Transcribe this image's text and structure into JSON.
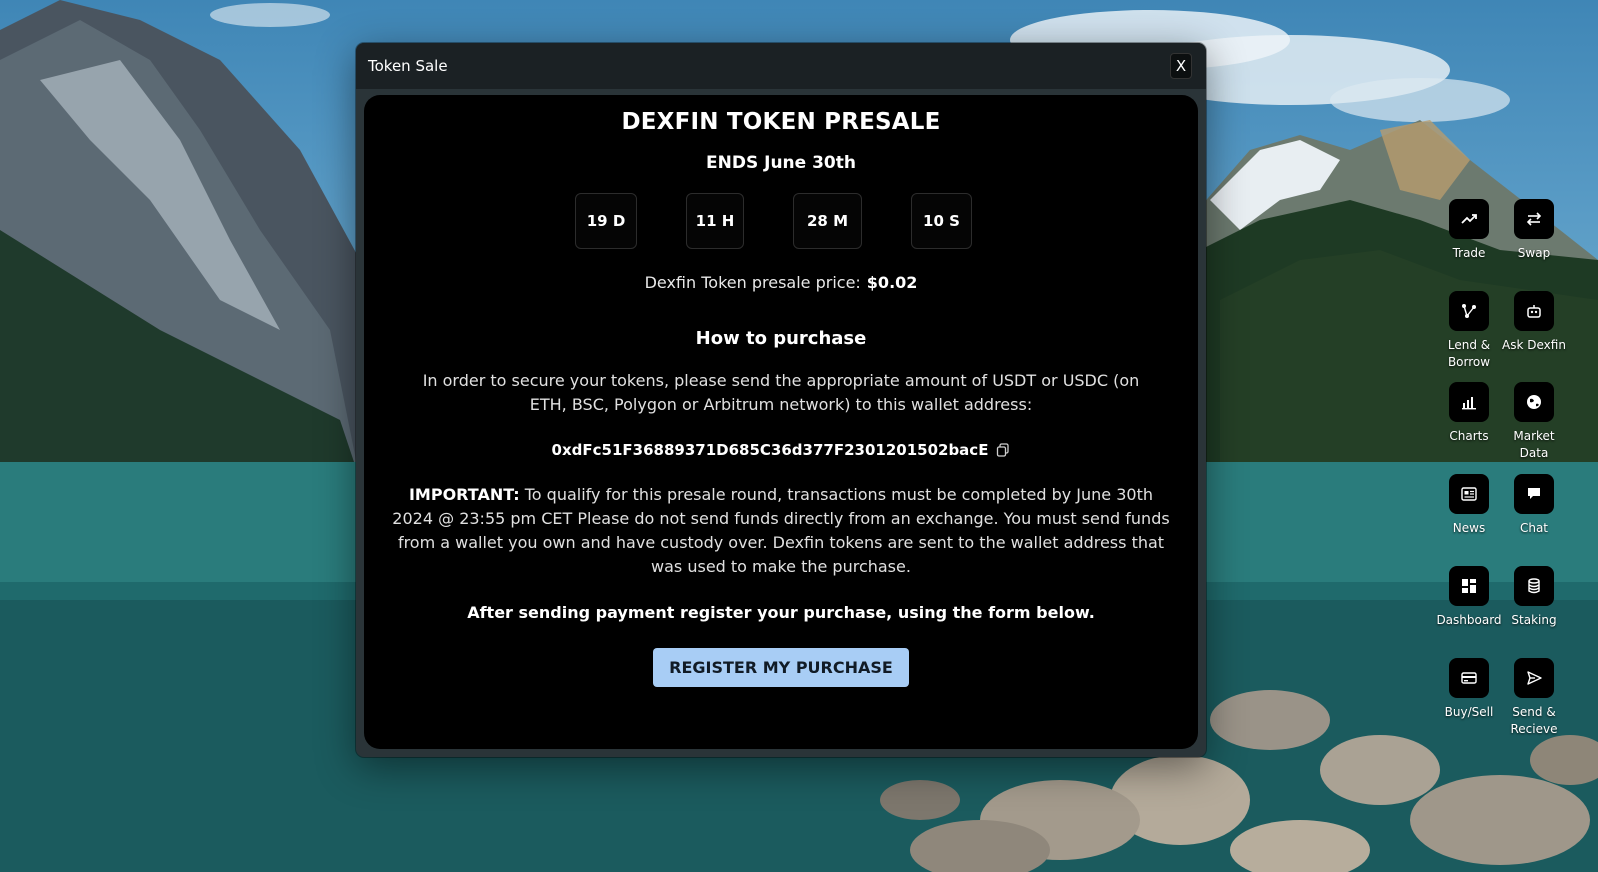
{
  "window": {
    "title": "Token Sale",
    "close_label": "X"
  },
  "presale": {
    "heading": "DEXFIN TOKEN PRESALE",
    "ends": "ENDS June 30th",
    "countdown": {
      "days": "19 D",
      "hours": "11 H",
      "minutes": "28 M",
      "seconds": "10 S"
    },
    "price_label": "Dexfin Token presale price:",
    "price_value": "$0.02",
    "how_heading": "How to purchase",
    "instructions": "In order to secure your tokens, please send the appropriate amount of USDT or USDC (on ETH, BSC, Polygon or Arbitrum network) to this wallet address:",
    "wallet_address": "0xdFc51F36889371D685C36d377F2301201502bacE",
    "important_label": "IMPORTANT:",
    "important_text": " To qualify for this presale round, transactions must be completed by June 30th 2024 @ 23:55 pm CET Please do not send funds directly from an exchange. You must send funds from a wallet you own and have custody over. Dexfin tokens are sent to the wallet address that was used to make the purchase.",
    "after_text": "After sending payment register your purchase, using the form below.",
    "register_button": "REGISTER MY PURCHASE"
  },
  "desktop_icons": [
    {
      "label": "Trade",
      "icon": "trend-up-icon"
    },
    {
      "label": "Swap",
      "icon": "swap-arrows-icon"
    },
    {
      "label": "Lend & Borrow",
      "icon": "nodes-icon"
    },
    {
      "label": "Ask Dexfin",
      "icon": "robot-icon"
    },
    {
      "label": "Charts",
      "icon": "bar-chart-icon"
    },
    {
      "label": "Market Data",
      "icon": "globe-icon"
    },
    {
      "label": "News",
      "icon": "newspaper-icon"
    },
    {
      "label": "Chat",
      "icon": "chat-bubble-icon"
    },
    {
      "label": "Dashboard",
      "icon": "dashboard-grid-icon"
    },
    {
      "label": "Staking",
      "icon": "database-stack-icon"
    },
    {
      "label": "Buy/Sell",
      "icon": "credit-card-icon"
    },
    {
      "label": "Send & Recieve",
      "icon": "send-plane-icon"
    }
  ],
  "colors": {
    "panel_bg": "#000000",
    "titlebar_bg": "#1b2124",
    "button_bg": "#a8cdf5",
    "button_text": "#111b26"
  }
}
